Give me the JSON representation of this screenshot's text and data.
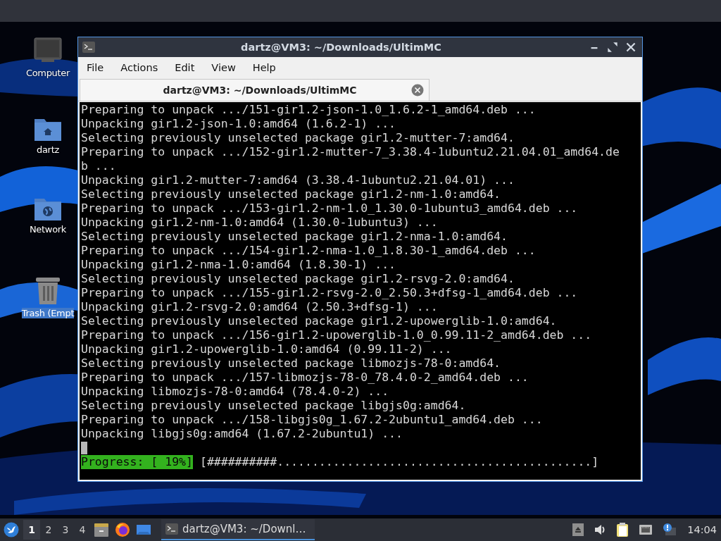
{
  "desktop_icons": [
    {
      "kind": "computer",
      "label": "Computer",
      "selected": false
    },
    {
      "kind": "home",
      "label": "dartz",
      "selected": false
    },
    {
      "kind": "network",
      "label": "Network",
      "selected": false
    },
    {
      "kind": "trash",
      "label": "Trash (Empt",
      "selected": true
    }
  ],
  "window": {
    "title": "dartz@VM3: ~/Downloads/UltimMC",
    "menu": [
      "File",
      "Actions",
      "Edit",
      "View",
      "Help"
    ],
    "tabs": [
      {
        "label": "dartz@VM3: ~/Downloads/UltimMC",
        "selected": true
      }
    ],
    "terminal_lines": [
      "Preparing to unpack .../151-gir1.2-json-1.0_1.6.2-1_amd64.deb ...",
      "Unpacking gir1.2-json-1.0:amd64 (1.6.2-1) ...",
      "Selecting previously unselected package gir1.2-mutter-7:amd64.",
      "Preparing to unpack .../152-gir1.2-mutter-7_3.38.4-1ubuntu2.21.04.01_amd64.de",
      "b ...",
      "Unpacking gir1.2-mutter-7:amd64 (3.38.4-1ubuntu2.21.04.01) ...",
      "Selecting previously unselected package gir1.2-nm-1.0:amd64.",
      "Preparing to unpack .../153-gir1.2-nm-1.0_1.30.0-1ubuntu3_amd64.deb ...",
      "Unpacking gir1.2-nm-1.0:amd64 (1.30.0-1ubuntu3) ...",
      "Selecting previously unselected package gir1.2-nma-1.0:amd64.",
      "Preparing to unpack .../154-gir1.2-nma-1.0_1.8.30-1_amd64.deb ...",
      "Unpacking gir1.2-nma-1.0:amd64 (1.8.30-1) ...",
      "Selecting previously unselected package gir1.2-rsvg-2.0:amd64.",
      "Preparing to unpack .../155-gir1.2-rsvg-2.0_2.50.3+dfsg-1_amd64.deb ...",
      "Unpacking gir1.2-rsvg-2.0:amd64 (2.50.3+dfsg-1) ...",
      "Selecting previously unselected package gir1.2-upowerglib-1.0:amd64.",
      "Preparing to unpack .../156-gir1.2-upowerglib-1.0_0.99.11-2_amd64.deb ...",
      "Unpacking gir1.2-upowerglib-1.0:amd64 (0.99.11-2) ...",
      "Selecting previously unselected package libmozjs-78-0:amd64.",
      "Preparing to unpack .../157-libmozjs-78-0_78.4.0-2_amd64.deb ...",
      "Unpacking libmozjs-78-0:amd64 (78.4.0-2) ...",
      "Selecting previously unselected package libgjs0g:amd64.",
      "Preparing to unpack .../158-libgjs0g_1.67.2-2ubuntu1_amd64.deb ...",
      "Unpacking libgjs0g:amd64 (1.67.2-2ubuntu1) ..."
    ],
    "progress": {
      "label": "Progress: [ 19%]",
      "bar": "[##########.............................................]"
    }
  },
  "taskbar": {
    "workspaces": [
      {
        "label": "1",
        "selected": true
      },
      {
        "label": "2",
        "selected": false
      },
      {
        "label": "3",
        "selected": false
      },
      {
        "label": "4",
        "selected": false
      }
    ],
    "launchers": [
      {
        "kind": "files"
      },
      {
        "kind": "browser"
      },
      {
        "kind": "desktop"
      }
    ],
    "tasks": [
      {
        "label": "dartz@VM3: ~/Downl…",
        "selected": true
      }
    ],
    "tray": [
      {
        "kind": "eject"
      },
      {
        "kind": "volume"
      },
      {
        "kind": "clipboard"
      },
      {
        "kind": "network"
      },
      {
        "kind": "notification"
      }
    ],
    "clock": "14:04"
  }
}
